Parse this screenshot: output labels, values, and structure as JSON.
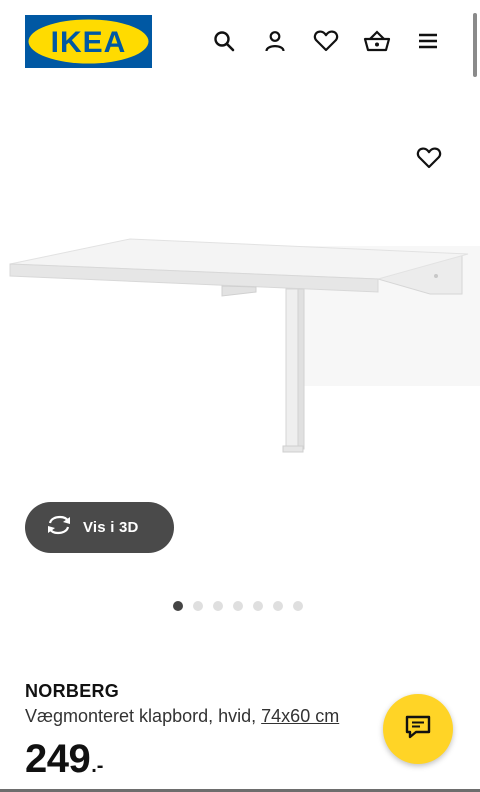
{
  "header": {
    "logo_text": "IKEA",
    "icons": [
      "search-icon",
      "account-icon",
      "heart-icon",
      "basket-icon",
      "menu-icon"
    ]
  },
  "colors": {
    "brand_blue": "#0058a3",
    "brand_yellow": "#ffdb00",
    "chat_yellow": "#ffd426",
    "pill_bg": "#4a4a4a"
  },
  "gallery": {
    "view_3d_label": "Vis i 3D",
    "image_count": 7,
    "active_index": 0
  },
  "product": {
    "name": "NORBERG",
    "description": "Vægmonteret klapbord, hvid,",
    "size": "74x60 cm",
    "price_integer": "249",
    "price_decimal": ".-"
  }
}
